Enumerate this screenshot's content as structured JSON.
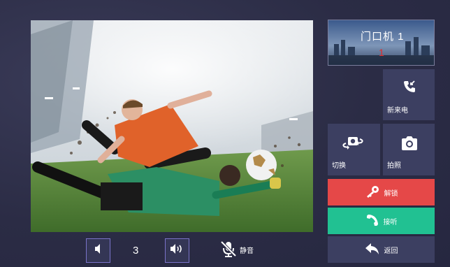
{
  "door_station": {
    "title": "门口机 1",
    "number": "1"
  },
  "buttons": {
    "new_call": "新来电",
    "switch": "切换",
    "photo": "拍照",
    "unlock": "解锁",
    "answer": "接听",
    "back": "返回"
  },
  "volume": {
    "level": "3"
  },
  "mute_label": "静音",
  "icons": {
    "new_call": "phone-incoming-icon",
    "switch": "camera-switch-icon",
    "photo": "camera-icon",
    "unlock": "key-icon",
    "answer": "phone-icon",
    "back": "back-arrow-icon",
    "vol_down": "volume-down-icon",
    "vol_up": "volume-up-icon",
    "mute": "mic-off-icon"
  },
  "colors": {
    "background": "#2b2c45",
    "tile": "#3c3f61",
    "unlock": "#e54848",
    "answer": "#21c192",
    "door_number": "#e02c2c"
  }
}
